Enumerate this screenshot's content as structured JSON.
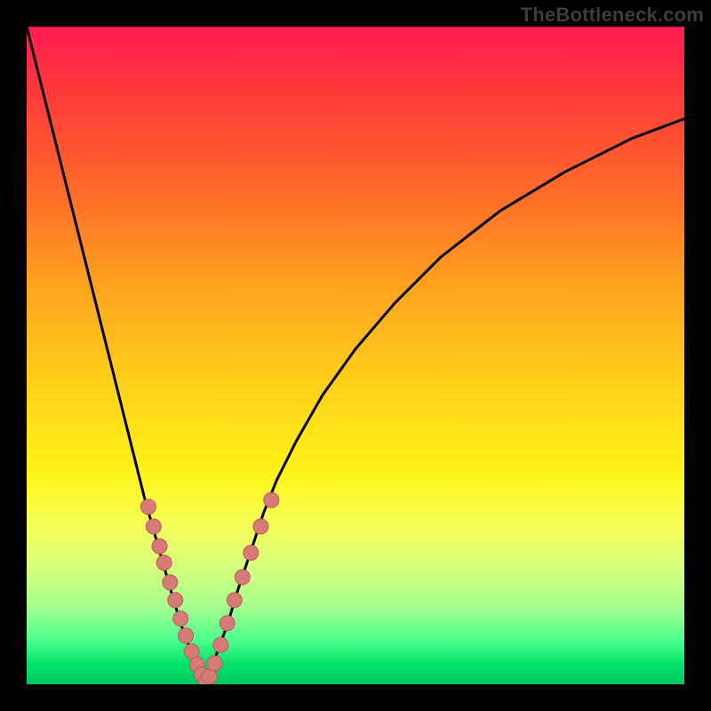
{
  "watermark": "TheBottleneck.com",
  "chart_data": {
    "type": "line",
    "title": "",
    "xlabel": "",
    "ylabel": "",
    "xlim": [
      0,
      100
    ],
    "ylim": [
      0,
      100
    ],
    "grid": false,
    "legend": false,
    "background": {
      "gradient": "vertical",
      "top_color": "#ff1b51",
      "bottom_color": "#02c85e"
    },
    "series": [
      {
        "name": "curve-left",
        "stroke": "#000000",
        "x": [
          0.0,
          2.0,
          4.0,
          6.0,
          8.0,
          10.0,
          12.0,
          14.0,
          16.0,
          18.0,
          20.0,
          22.0,
          23.5,
          25.0,
          26.0,
          27.0
        ],
        "y": [
          100.0,
          92.0,
          84.0,
          76.0,
          68.0,
          60.0,
          52.0,
          44.0,
          36.0,
          28.0,
          21.0,
          14.0,
          9.0,
          5.0,
          2.0,
          0.5
        ]
      },
      {
        "name": "curve-right",
        "stroke": "#000000",
        "x": [
          27.0,
          28.0,
          29.0,
          30.5,
          32.0,
          34.0,
          36.0,
          38.0,
          41.0,
          45.0,
          50.0,
          56.0,
          63.0,
          72.0,
          82.0,
          92.0,
          100.0
        ],
        "y": [
          0.5,
          2.0,
          5.0,
          9.0,
          14.0,
          20.0,
          26.0,
          31.0,
          37.0,
          44.0,
          51.0,
          58.0,
          65.0,
          72.0,
          78.0,
          83.0,
          86.0
        ]
      },
      {
        "name": "markers-left",
        "type": "scatter",
        "fill": "#d77b79",
        "stroke": "#b85b5b",
        "x": [
          18.5,
          19.3,
          20.2,
          20.9,
          21.8,
          22.6,
          23.4,
          24.2,
          25.1,
          25.9,
          26.6,
          27.3
        ],
        "y": [
          27.0,
          24.0,
          21.0,
          18.5,
          15.5,
          12.8,
          10.0,
          7.4,
          5.0,
          3.0,
          1.5,
          0.5
        ]
      },
      {
        "name": "markers-right",
        "type": "scatter",
        "fill": "#d77b79",
        "stroke": "#b85b5b",
        "x": [
          27.8,
          28.6,
          29.5,
          30.5,
          31.6,
          32.8,
          34.1,
          35.6,
          37.2
        ],
        "y": [
          1.2,
          3.2,
          6.0,
          9.3,
          12.8,
          16.3,
          20.0,
          24.0,
          28.0
        ]
      }
    ],
    "minimum": {
      "x": 27.0,
      "y": 0.5
    }
  }
}
